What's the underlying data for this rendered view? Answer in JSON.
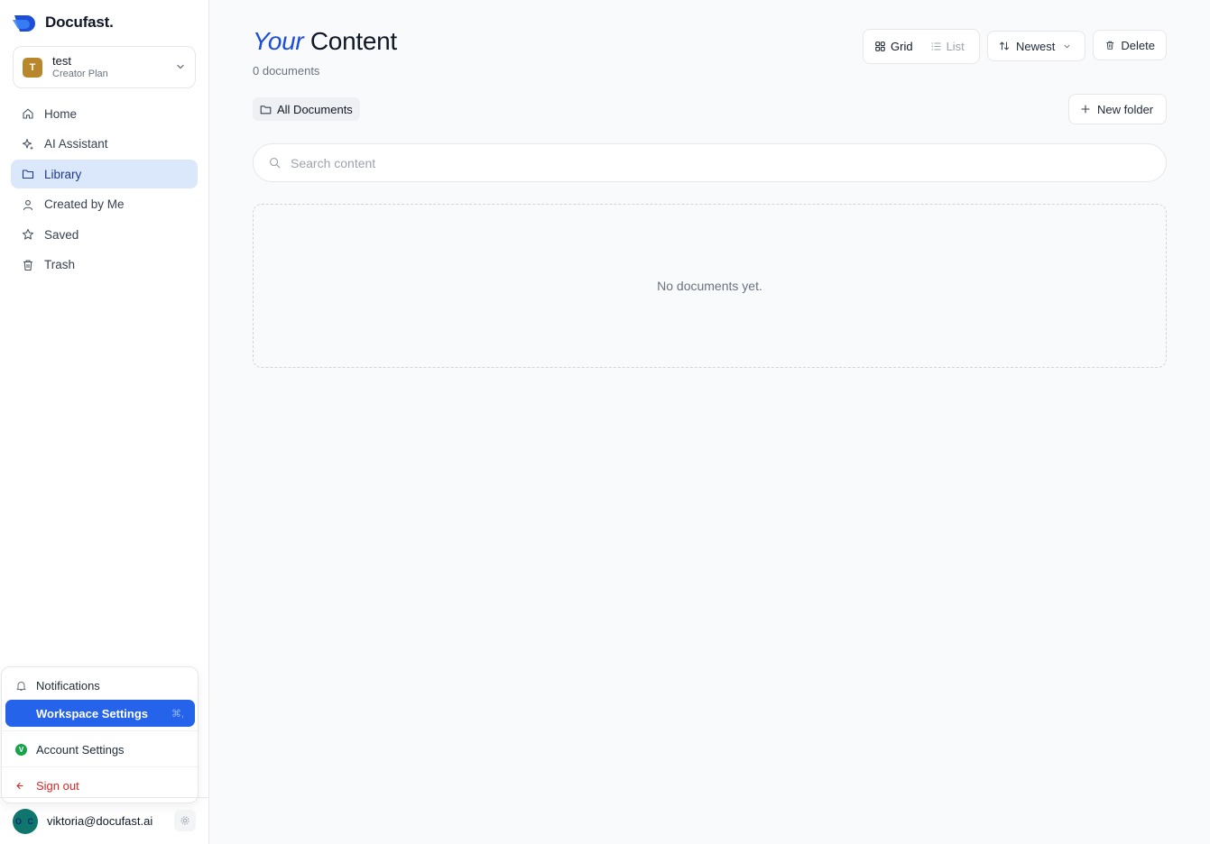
{
  "brand": {
    "name": "Docufast.",
    "logo_color": "#1d4ed8"
  },
  "workspace": {
    "initial": "T",
    "name": "test",
    "plan": "Creator Plan",
    "avatar_color": "#b8862b"
  },
  "sidebar": {
    "items": [
      {
        "label": "Home",
        "icon": "home-icon"
      },
      {
        "label": "AI Assistant",
        "icon": "sparkles-icon"
      },
      {
        "label": "Library",
        "icon": "folder-icon",
        "active": true
      },
      {
        "label": "Created by Me",
        "icon": "user-icon"
      },
      {
        "label": "Saved",
        "icon": "star-icon"
      },
      {
        "label": "Trash",
        "icon": "trash-icon"
      }
    ]
  },
  "menu": {
    "notifications": "Notifications",
    "workspace_settings": "Workspace Settings",
    "workspace_shortcut": "⌘,",
    "account_settings": "Account Settings",
    "account_initial": "V",
    "sign_out": "Sign out"
  },
  "user": {
    "avatar_text": "O C",
    "email": "viktoria@docufast.ai"
  },
  "main": {
    "title_em": "Your",
    "title_rest": "Content",
    "doc_count": "0 documents",
    "view": {
      "grid": "Grid",
      "list": "List",
      "selected": "Grid"
    },
    "sort_label": "Newest",
    "delete_label": "Delete",
    "folder_chip": "All Documents",
    "new_folder_label": "New folder",
    "search_placeholder": "Search content",
    "search_value": "",
    "empty_text": "No documents yet."
  },
  "colors": {
    "accent": "#2563eb",
    "active_nav_bg": "#dbe7fb",
    "danger": "#dc2626",
    "title_em": "#1d4ed8"
  }
}
